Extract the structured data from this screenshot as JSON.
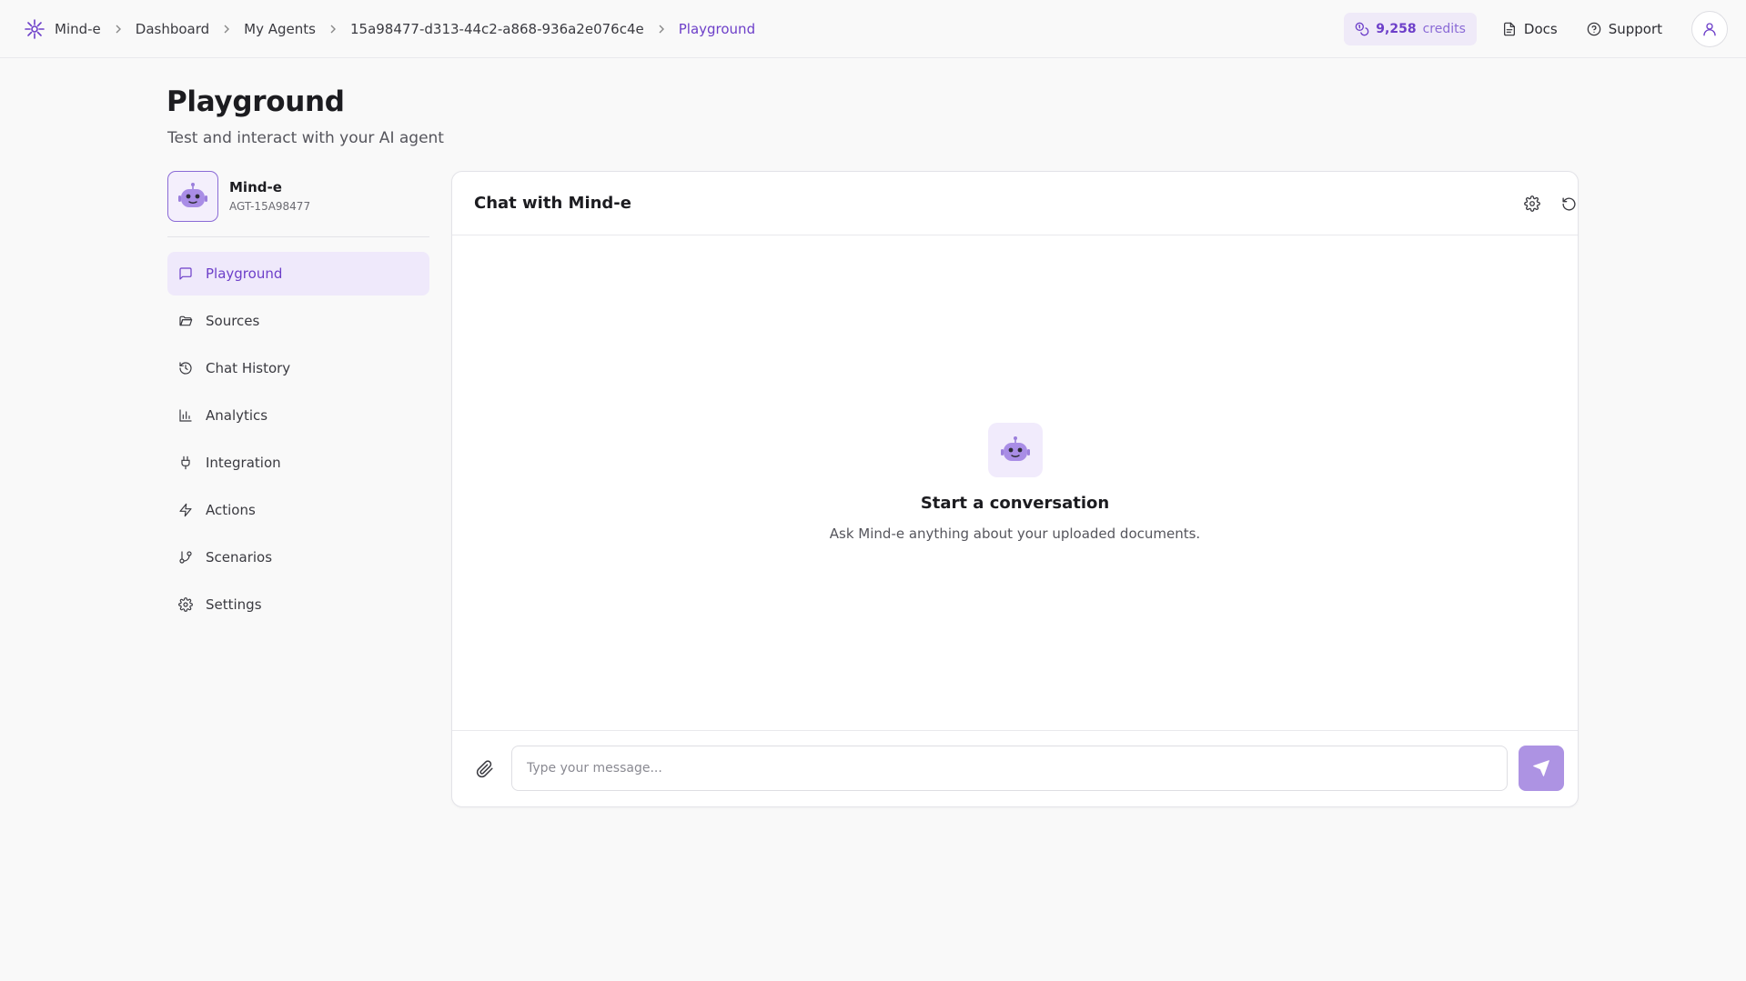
{
  "topbar": {
    "breadcrumbs": [
      {
        "label": "Mind-e"
      },
      {
        "label": "Dashboard"
      },
      {
        "label": "My Agents"
      },
      {
        "label": "15a98477-d313-44c2-a868-936a2e076c4e"
      },
      {
        "label": "Playground"
      }
    ],
    "credits": {
      "amount": "9,258",
      "label": "credits"
    },
    "docs_label": "Docs",
    "support_label": "Support"
  },
  "page": {
    "title": "Playground",
    "subtitle": "Test and interact with your AI agent"
  },
  "agent": {
    "name": "Mind-e",
    "id": "AGT-15A98477"
  },
  "sidebar": {
    "items": [
      {
        "label": "Playground",
        "icon": "message-square-icon",
        "active": true
      },
      {
        "label": "Sources",
        "icon": "folder-open-icon"
      },
      {
        "label": "Chat History",
        "icon": "history-icon"
      },
      {
        "label": "Analytics",
        "icon": "bar-chart-icon"
      },
      {
        "label": "Integration",
        "icon": "plug-icon"
      },
      {
        "label": "Actions",
        "icon": "zap-icon"
      },
      {
        "label": "Scenarios",
        "icon": "git-branch-icon"
      },
      {
        "label": "Settings",
        "icon": "gear-icon"
      }
    ]
  },
  "chat": {
    "title": "Chat with Mind-e",
    "empty_title": "Start a conversation",
    "empty_subtitle": "Ask Mind-e anything about your uploaded documents.",
    "input_placeholder": "Type your message..."
  },
  "colors": {
    "accent": "#6d3fc9",
    "accent_soft": "#efe9fb",
    "send_button": "#ad93e3",
    "background": "#f9f9f9"
  }
}
